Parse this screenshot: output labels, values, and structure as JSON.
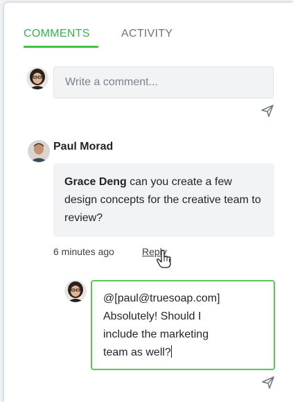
{
  "tabs": [
    {
      "label": "COMMENTS",
      "active": true
    },
    {
      "label": "ACTIVITY",
      "active": false
    }
  ],
  "composer": {
    "placeholder": "Write a comment...",
    "send_icon": "send-icon"
  },
  "comment": {
    "author": "Paul Morad",
    "mention": "Grace Deng",
    "body": " can you create a few design concepts for the creative team to review?",
    "time": "6 minutes ago",
    "reply_label": "Reply"
  },
  "reply": {
    "lines": [
      "@[paul@truesoap.com]",
      "Absolutely! Should I",
      "include the marketing",
      "team as well?"
    ],
    "send_icon": "send-icon"
  },
  "colors": {
    "accent": "#37b24d",
    "focus_border": "#56c85a",
    "inactive_tab": "#6b7380",
    "bubble_bg": "#f2f3f5"
  }
}
